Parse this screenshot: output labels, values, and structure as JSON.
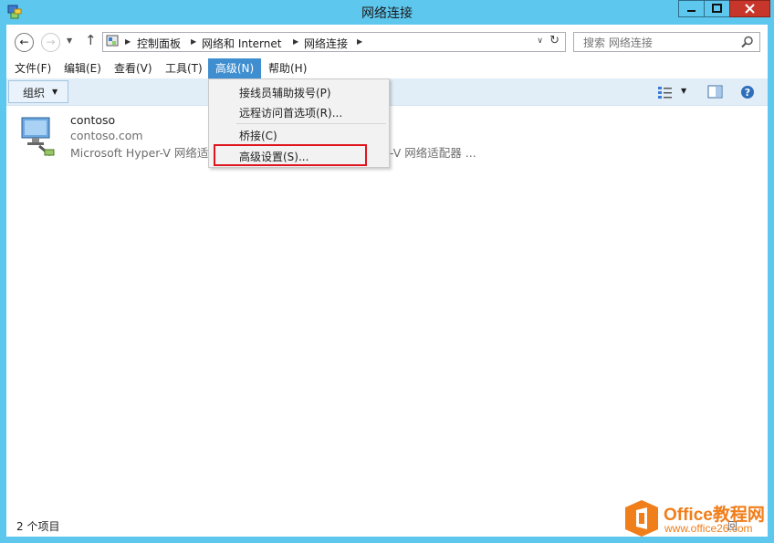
{
  "window": {
    "title": "网络连接",
    "controls": {
      "minimize": "minimize",
      "maximize": "maximize",
      "close": "close"
    }
  },
  "address": {
    "crumbs": [
      "控制面板",
      "网络和 Internet",
      "网络连接"
    ],
    "search_placeholder": "搜索 网络连接"
  },
  "menu": {
    "items": [
      {
        "label": "文件(F)"
      },
      {
        "label": "编辑(E)"
      },
      {
        "label": "查看(V)"
      },
      {
        "label": "工具(T)"
      },
      {
        "label": "高级(N)",
        "active": true
      },
      {
        "label": "帮助(H)"
      }
    ]
  },
  "toolbar": {
    "organize_label": "组织"
  },
  "advanced_menu": {
    "items": [
      {
        "label": "接线员辅助拨号(P)"
      },
      {
        "label": "远程访问首选项(R)..."
      },
      {
        "label": "桥接(C)"
      },
      {
        "label": "高级设置(S)...",
        "highlighted": true
      }
    ]
  },
  "connection": {
    "name": "contoso",
    "domain": "contoso.com",
    "adapter": "Microsoft Hyper-V 网络适配",
    "adapter_tail": "-V 网络适配器 ..."
  },
  "status": {
    "items_count": "2 个项目",
    "right_fragment": "回"
  },
  "watermark": {
    "title": "Office教程网",
    "url": "www.office26.com"
  },
  "colors": {
    "titlebar": "#5ec7ee",
    "menu_active": "#3e8ed0",
    "highlight": "#e0141e",
    "watermark": "#f07e1a"
  }
}
